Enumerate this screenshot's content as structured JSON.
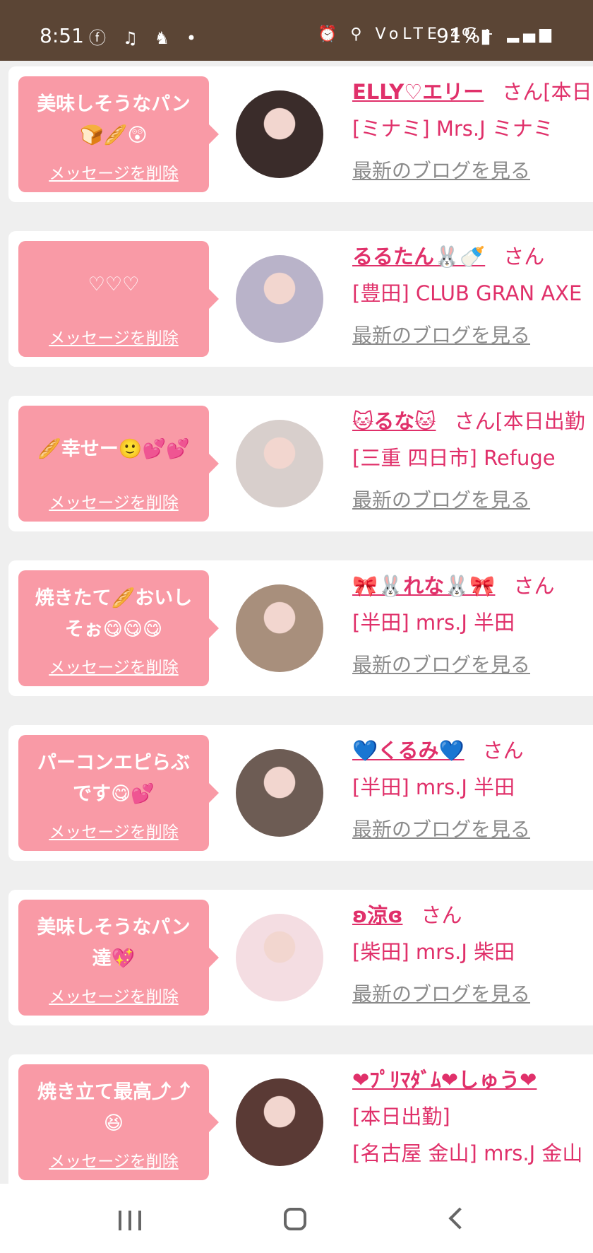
{
  "status_bar": {
    "time": "8:51",
    "left_icons": "ⓕ ♫ ♞ •",
    "right_icons": "⏰ ⚲ VoLTE 4G+ ▂▄▆",
    "battery": "91%▮"
  },
  "cards": [
    {
      "message": "美味しそうなパン\n🍞🥖😲",
      "delete_label": "メッセージを削除",
      "name": "ELLY♡エリー",
      "suffix": "さん[本日",
      "shop": "[ミナミ] Mrs.J ミナミ",
      "blog_label": "最新のブログを見る",
      "avatar_color": "#3a2c2a"
    },
    {
      "message": "♡♡♡",
      "delete_label": "メッセージを削除",
      "name": "るるたん🐰🍼",
      "suffix": "さん",
      "shop": "[豊田] CLUB GRAN AXE",
      "blog_label": "最新のブログを見る",
      "avatar_color": "#b9b3c9"
    },
    {
      "message": "🥖幸せー🙂💕💕",
      "delete_label": "メッセージを削除",
      "name": "🐱るな🐱",
      "suffix": "さん[本日出勤",
      "shop": "[三重 四日市] Refuge",
      "blog_label": "最新のブログを見る",
      "avatar_color": "#d8cfcc"
    },
    {
      "message": "焼きたて🥖おいし\nそぉ😋😋😋",
      "delete_label": "メッセージを削除",
      "name": "🎀🐰れな🐰🎀",
      "suffix": "さん",
      "shop": "[半田] mrs.J 半田",
      "blog_label": "最新のブログを見る",
      "avatar_color": "#a88f7c"
    },
    {
      "message": "パーコンエピらぶ\nです😋💕",
      "delete_label": "メッセージを削除",
      "name": "💙くるみ💙",
      "suffix": "さん",
      "shop": "[半田] mrs.J 半田",
      "blog_label": "最新のブログを見る",
      "avatar_color": "#6d5c54"
    },
    {
      "message": "美味しそうなパン\n達💖",
      "delete_label": "メッセージを削除",
      "name": "ʚ涼ɞ",
      "suffix": "さん",
      "shop": "[柴田] mrs.J 柴田",
      "blog_label": "最新のブログを見る",
      "avatar_color": "#f4dde2"
    },
    {
      "message": "焼き立て最高⤴⤴\n😆",
      "delete_label": "メッセージを削除",
      "name": "❤ﾌﾟﾘﾏﾀﾞﾑ❤しゅう❤",
      "suffix": "",
      "extra": "[本日出勤]",
      "shop": "[名古屋 金山] mrs.J 金山",
      "blog_label": "",
      "avatar_color": "#5a3a35"
    }
  ],
  "theme": {
    "bubble": "#f99aa6",
    "name": "#e0306a",
    "link": "#8b8b8b",
    "statusbar": "#5b4535"
  }
}
